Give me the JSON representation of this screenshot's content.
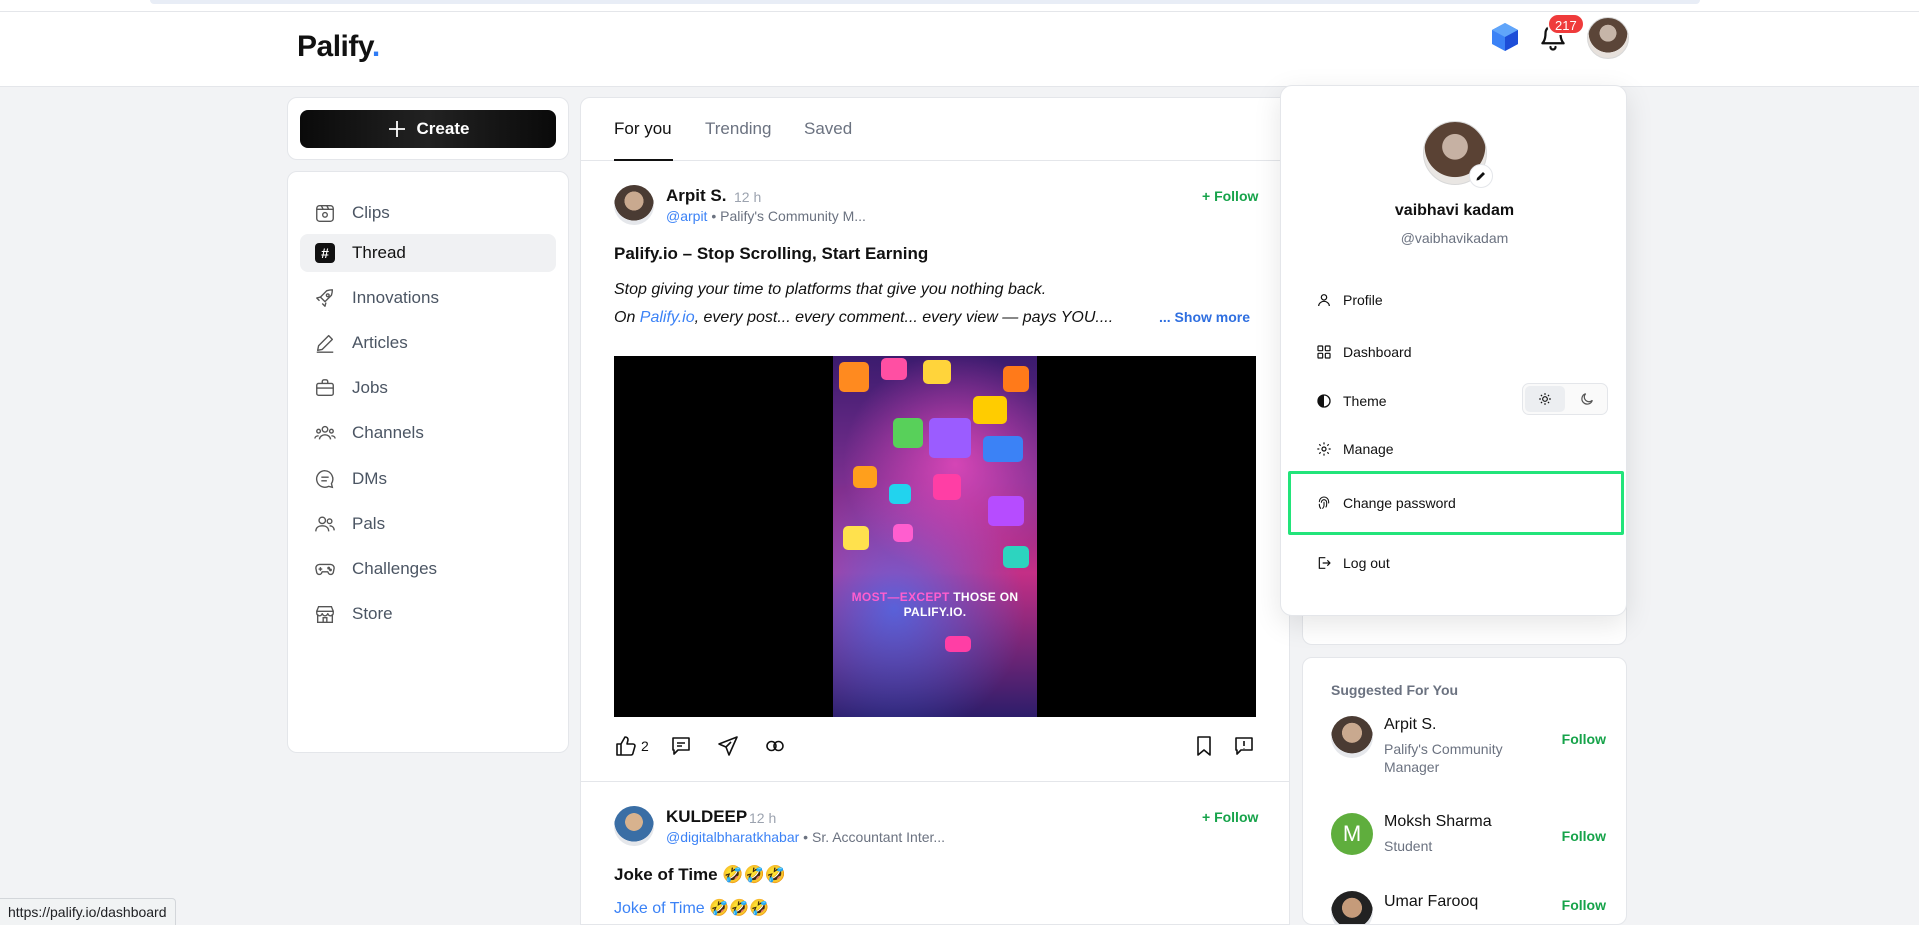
{
  "header": {
    "logo_text": "Palify",
    "logo_dot": ".",
    "notification_count": "217",
    "icons": [
      "gem-cube-icon",
      "bell-icon",
      "avatar"
    ]
  },
  "create_button": {
    "label": "Create"
  },
  "nav": {
    "items": [
      {
        "label": "Clips",
        "icon": "clips-icon"
      },
      {
        "label": "Thread",
        "icon": "hash-icon",
        "active": true
      },
      {
        "label": "Innovations",
        "icon": "rocket-icon"
      },
      {
        "label": "Articles",
        "icon": "pencil-icon"
      },
      {
        "label": "Jobs",
        "icon": "briefcase-icon"
      },
      {
        "label": "Channels",
        "icon": "users-icon"
      },
      {
        "label": "DMs",
        "icon": "chat-icon"
      },
      {
        "label": "Pals",
        "icon": "pals-icon"
      },
      {
        "label": "Challenges",
        "icon": "gamepad-icon"
      },
      {
        "label": "Store",
        "icon": "store-icon"
      }
    ]
  },
  "feed": {
    "tabs": [
      {
        "label": "For you",
        "active": true
      },
      {
        "label": "Trending"
      },
      {
        "label": "Saved"
      }
    ],
    "posts": [
      {
        "author": "Arpit S.",
        "time": "12 h",
        "handle": "@arpit",
        "meta": " • Palify's Community M...",
        "follow": "+ Follow",
        "title": "Palify.io – Stop Scrolling, Start Earning",
        "body_line1": "Stop giving your time to platforms that give you nothing back.",
        "body_line2_pre": "On ",
        "body_line2_link": "Palify.io",
        "body_line2_post": ", every post... every comment... every view — pays YOU....",
        "show_more": "... Show more",
        "video_caption_pink": "MOST—EXCEPT",
        "video_caption_white": " THOSE ON PALIFY.IO.",
        "likes": "2"
      },
      {
        "author": "KULDEEP",
        "time": "12 h",
        "handle": "@digitalbharatkhabar",
        "meta": " • Sr. Accountant Inter...",
        "follow": "+ Follow",
        "title": "Joke of Time 🤣🤣🤣",
        "body_link": "Joke of Time 🤣🤣🤣"
      }
    ]
  },
  "dropdown": {
    "name": "vaibhavi kadam",
    "handle": "@vaibhavikadam",
    "items": [
      {
        "label": "Profile",
        "icon": "person-icon"
      },
      {
        "label": "Dashboard",
        "icon": "grid-icon"
      },
      {
        "label": "Theme",
        "icon": "contrast-icon"
      },
      {
        "label": "Manage",
        "icon": "gear-icon"
      },
      {
        "label": "Change password",
        "icon": "fingerprint-icon",
        "highlighted": true
      },
      {
        "label": "Log out",
        "icon": "logout-icon"
      }
    ],
    "highlight_color": "#22e47a"
  },
  "suggested": {
    "heading": "Suggested For You",
    "people": [
      {
        "name": "Arpit S.",
        "role": "Palify's Community Manager",
        "follow": "Follow"
      },
      {
        "name": "Moksh Sharma",
        "role": "Student",
        "initial": "M",
        "follow": "Follow"
      },
      {
        "name": "Umar Farooq",
        "role": "",
        "follow": "Follow"
      }
    ]
  },
  "status_bar": {
    "url": "https://palify.io/dashboard"
  },
  "colors": {
    "accent_green": "#16a34a",
    "link_blue": "#3b82f6",
    "badge_red": "#ef3b3b"
  }
}
